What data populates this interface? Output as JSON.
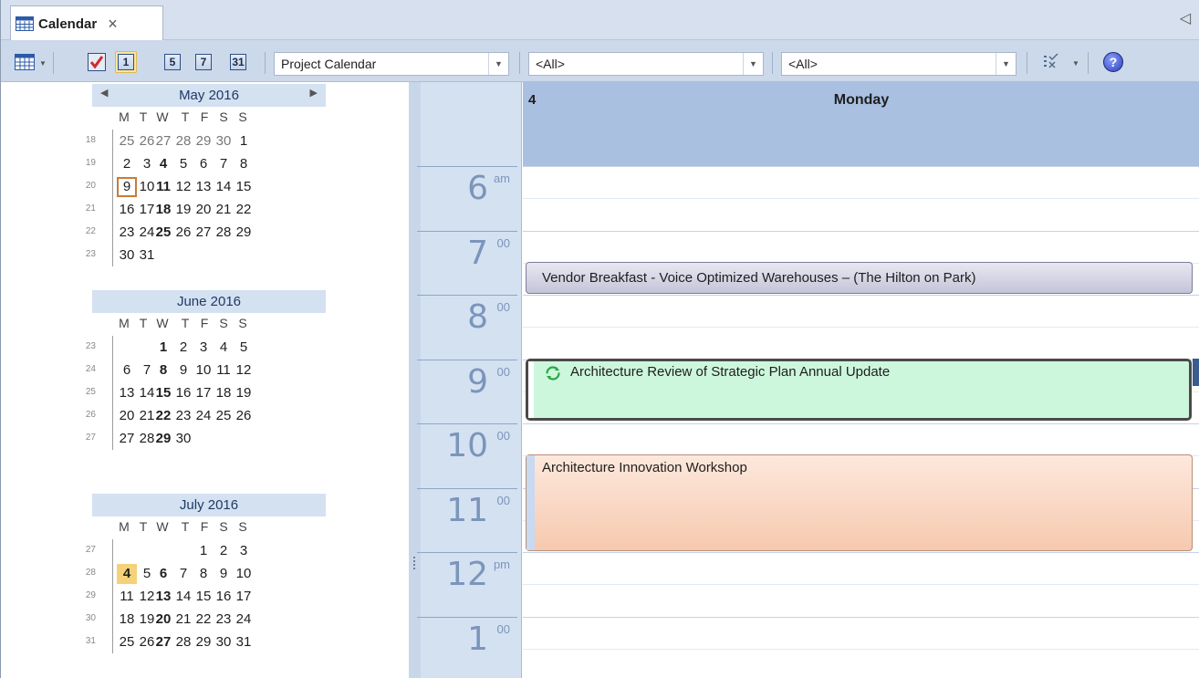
{
  "tab": {
    "title": "Calendar",
    "close": "×",
    "collapse": "◁"
  },
  "toolbar": {
    "calendar_combo": "Project Calendar",
    "filter1": "<All>",
    "filter2": "<All>",
    "day1": "1",
    "day5": "5",
    "day7": "7",
    "day31": "31",
    "help": "?"
  },
  "minical": {
    "dow": [
      "M",
      "T",
      "W",
      "T",
      "F",
      "S",
      "S"
    ],
    "prev": "◀",
    "next": "▶",
    "months": [
      {
        "title": "May 2016",
        "weeks": [
          {
            "wk": "18",
            "days": [
              "25",
              "26",
              "27",
              "28",
              "29",
              "30",
              "1"
            ]
          },
          {
            "wk": "19",
            "days": [
              "2",
              "3",
              "4",
              "5",
              "6",
              "7",
              "8"
            ]
          },
          {
            "wk": "20",
            "days": [
              "9",
              "10",
              "11",
              "12",
              "13",
              "14",
              "15"
            ]
          },
          {
            "wk": "21",
            "days": [
              "16",
              "17",
              "18",
              "19",
              "20",
              "21",
              "22"
            ]
          },
          {
            "wk": "22",
            "days": [
              "23",
              "24",
              "25",
              "26",
              "27",
              "28",
              "29"
            ]
          },
          {
            "wk": "23",
            "days": [
              "30",
              "31",
              "",
              "",
              "",
              "",
              ""
            ]
          }
        ]
      },
      {
        "title": "June 2016",
        "weeks": [
          {
            "wk": "23",
            "days": [
              "",
              "",
              "1",
              "2",
              "3",
              "4",
              "5"
            ]
          },
          {
            "wk": "24",
            "days": [
              "6",
              "7",
              "8",
              "9",
              "10",
              "11",
              "12"
            ]
          },
          {
            "wk": "25",
            "days": [
              "13",
              "14",
              "15",
              "16",
              "17",
              "18",
              "19"
            ]
          },
          {
            "wk": "26",
            "days": [
              "20",
              "21",
              "22",
              "23",
              "24",
              "25",
              "26"
            ]
          },
          {
            "wk": "27",
            "days": [
              "27",
              "28",
              "29",
              "30",
              "",
              "",
              ""
            ]
          }
        ]
      },
      {
        "title": "July 2016",
        "weeks": [
          {
            "wk": "27",
            "days": [
              "",
              "",
              "",
              "",
              "1",
              "2",
              "3"
            ]
          },
          {
            "wk": "28",
            "days": [
              "4",
              "5",
              "6",
              "7",
              "8",
              "9",
              "10"
            ]
          },
          {
            "wk": "29",
            "days": [
              "11",
              "12",
              "13",
              "14",
              "15",
              "16",
              "17"
            ]
          },
          {
            "wk": "30",
            "days": [
              "18",
              "19",
              "20",
              "21",
              "22",
              "23",
              "24"
            ]
          },
          {
            "wk": "31",
            "days": [
              "25",
              "26",
              "27",
              "28",
              "29",
              "30",
              "31"
            ]
          }
        ]
      }
    ]
  },
  "timecol": {
    "hours": [
      {
        "num": "6",
        "sup": "am"
      },
      {
        "num": "7",
        "sup": "00"
      },
      {
        "num": "8",
        "sup": "00"
      },
      {
        "num": "9",
        "sup": "00"
      },
      {
        "num": "10",
        "sup": "00"
      },
      {
        "num": "11",
        "sup": "00"
      },
      {
        "num": "12",
        "sup": "pm"
      },
      {
        "num": "1",
        "sup": "00"
      }
    ]
  },
  "day": {
    "number": "4",
    "name": "Monday"
  },
  "appointments": {
    "breakfast": "Vendor Breakfast - Voice Optimized Warehouses – (The Hilton on Park)",
    "review": "Architecture Review of Strategic Plan Annual Update",
    "workshop": "Architecture Innovation Workshop"
  }
}
